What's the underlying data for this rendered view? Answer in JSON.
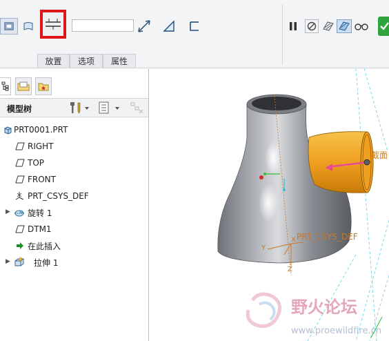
{
  "dashboard": {
    "tabs": [
      "放置",
      "选项",
      "属性"
    ],
    "depth_value": ""
  },
  "model_tree": {
    "title": "模型树",
    "items": [
      {
        "label": "PRT0001.PRT"
      },
      {
        "label": "RIGHT"
      },
      {
        "label": "TOP"
      },
      {
        "label": "FRONT"
      },
      {
        "label": "PRT_CSYS_DEF"
      },
      {
        "label": "旋转 1"
      },
      {
        "label": "DTM1"
      },
      {
        "label": "在此插入"
      },
      {
        "label": "拉伸 1"
      }
    ]
  },
  "viewport": {
    "section_label": "截面",
    "csys_label": "PRT_CSYS_DEF",
    "axis_x": "X",
    "axis_y": "Y",
    "axis_z": "Z",
    "watermark_title": "野火论坛",
    "watermark_url": "www.proewildfire.cn"
  },
  "colors": {
    "highlight_border": "#e0141b",
    "body_gray": "#8d9096",
    "extrude_orange": "#f0a020",
    "accent_green": "#2ea43a"
  }
}
